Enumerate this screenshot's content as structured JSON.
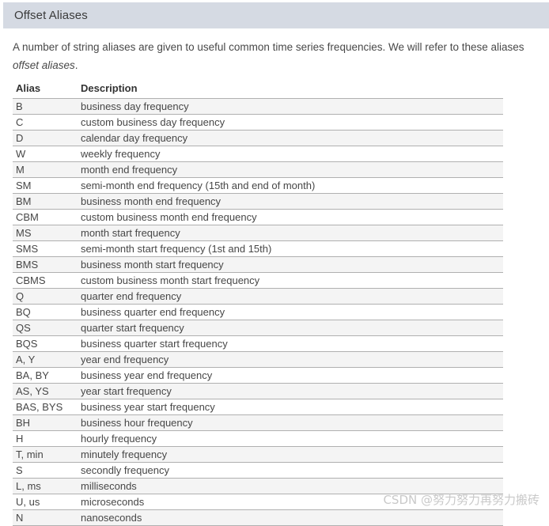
{
  "section": {
    "title": "Offset Aliases",
    "header_bg": "#d5dae3"
  },
  "intro": {
    "line1": "A number of string aliases are given to useful common time series frequencies. We will refer to these aliases",
    "line2_italic": "offset aliases",
    "line2_tail": "."
  },
  "table": {
    "columns": [
      "Alias",
      "Description"
    ],
    "rows": [
      {
        "alias": "B",
        "description": "business day frequency"
      },
      {
        "alias": "C",
        "description": "custom business day frequency"
      },
      {
        "alias": "D",
        "description": "calendar day frequency"
      },
      {
        "alias": "W",
        "description": "weekly frequency"
      },
      {
        "alias": "M",
        "description": "month end frequency"
      },
      {
        "alias": "SM",
        "description": "semi-month end frequency (15th and end of month)"
      },
      {
        "alias": "BM",
        "description": "business month end frequency"
      },
      {
        "alias": "CBM",
        "description": "custom business month end frequency"
      },
      {
        "alias": "MS",
        "description": "month start frequency"
      },
      {
        "alias": "SMS",
        "description": "semi-month start frequency (1st and 15th)"
      },
      {
        "alias": "BMS",
        "description": "business month start frequency"
      },
      {
        "alias": "CBMS",
        "description": "custom business month start frequency"
      },
      {
        "alias": "Q",
        "description": "quarter end frequency"
      },
      {
        "alias": "BQ",
        "description": "business quarter end frequency"
      },
      {
        "alias": "QS",
        "description": "quarter start frequency"
      },
      {
        "alias": "BQS",
        "description": "business quarter start frequency"
      },
      {
        "alias": "A, Y",
        "description": "year end frequency"
      },
      {
        "alias": "BA, BY",
        "description": "business year end frequency"
      },
      {
        "alias": "AS, YS",
        "description": "year start frequency"
      },
      {
        "alias": "BAS, BYS",
        "description": "business year start frequency"
      },
      {
        "alias": "BH",
        "description": "business hour frequency"
      },
      {
        "alias": "H",
        "description": "hourly frequency"
      },
      {
        "alias": "T, min",
        "description": "minutely frequency"
      },
      {
        "alias": "S",
        "description": "secondly frequency"
      },
      {
        "alias": "L, ms",
        "description": "milliseconds"
      },
      {
        "alias": "U, us",
        "description": "microseconds"
      },
      {
        "alias": "N",
        "description": "nanoseconds"
      }
    ]
  },
  "watermark": {
    "text": "CSDN @努力努力再努力搬砖"
  }
}
